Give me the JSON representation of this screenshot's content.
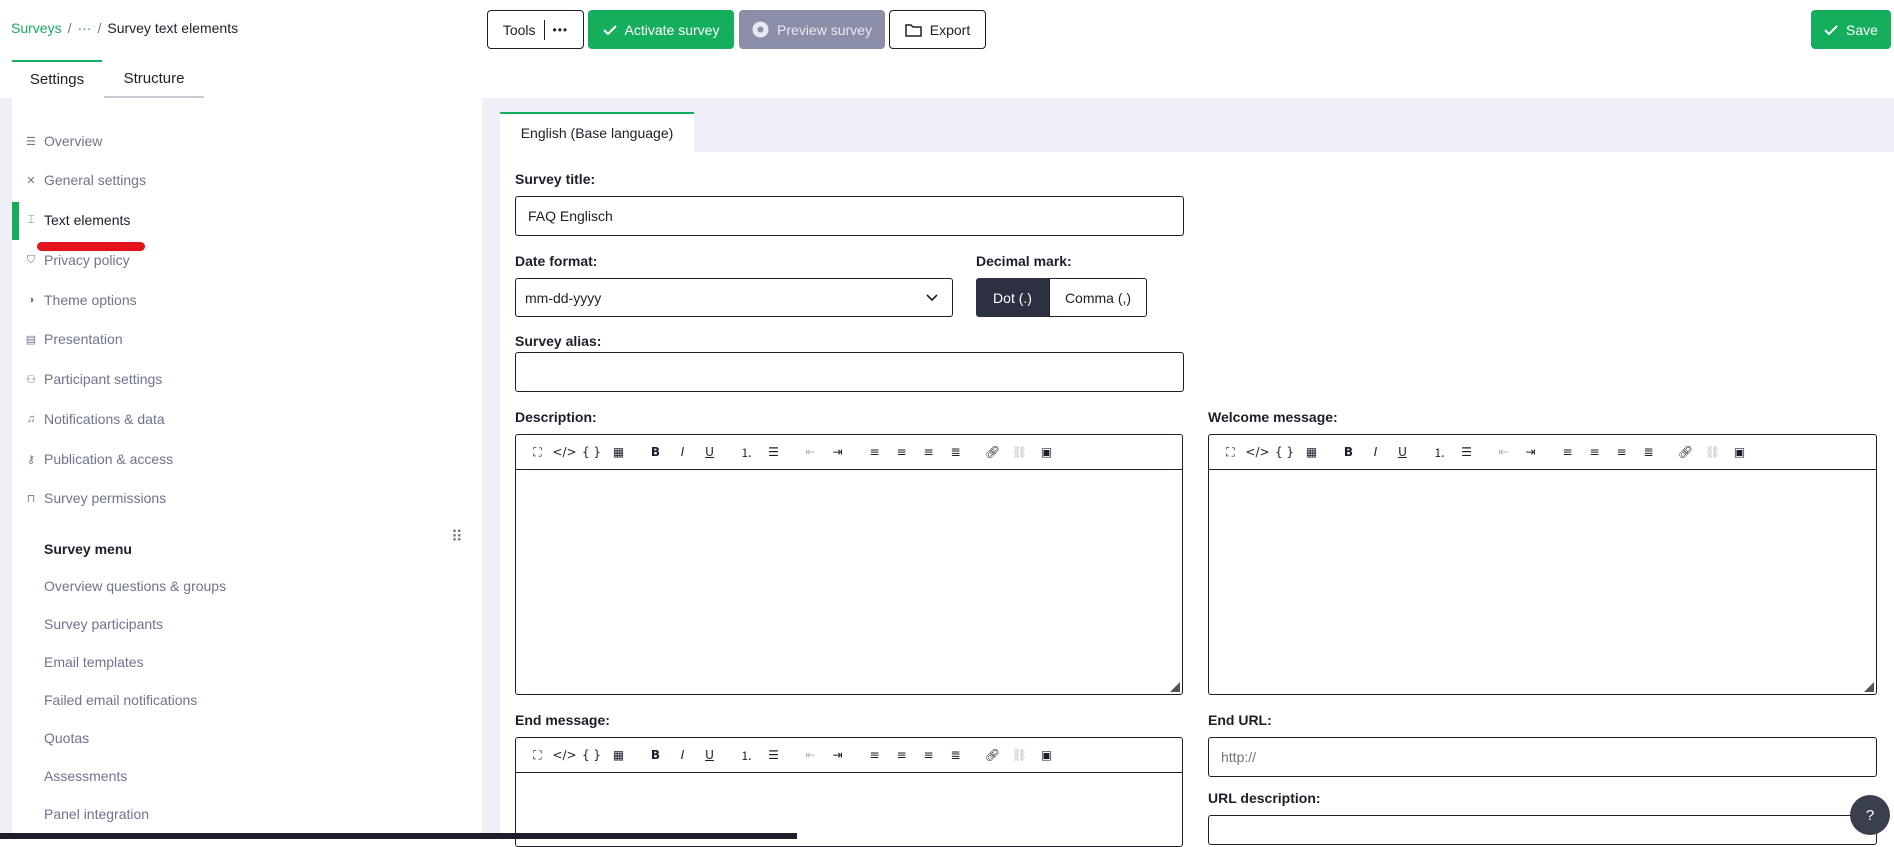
{
  "breadcrumb": {
    "root": "Surveys",
    "ellipsis": "···",
    "current": "Survey text elements"
  },
  "toolbar": {
    "tools_label": "Tools",
    "tools_more": "•••",
    "activate_label": "Activate survey",
    "preview_label": "Preview survey",
    "export_label": "Export",
    "save_label": "Save"
  },
  "main_tabs": [
    {
      "label": "Settings"
    },
    {
      "label": "Structure"
    }
  ],
  "settings_nav": [
    {
      "label": "Overview",
      "icon": "list-icon"
    },
    {
      "label": "General settings",
      "icon": "tools-icon"
    },
    {
      "label": "Text elements",
      "icon": "text-icon"
    },
    {
      "label": "Privacy policy",
      "icon": "shield-icon"
    },
    {
      "label": "Theme options",
      "icon": "contrast-icon"
    },
    {
      "label": "Presentation",
      "icon": "presentation-icon"
    },
    {
      "label": "Participant settings",
      "icon": "participants-icon"
    },
    {
      "label": "Notifications & data",
      "icon": "bell-icon"
    },
    {
      "label": "Publication & access",
      "icon": "key-icon"
    },
    {
      "label": "Survey permissions",
      "icon": "lock-icon"
    }
  ],
  "survey_menu": {
    "title": "Survey menu",
    "items": [
      {
        "label": "Overview questions & groups"
      },
      {
        "label": "Survey participants"
      },
      {
        "label": "Email templates"
      },
      {
        "label": "Failed email notifications"
      },
      {
        "label": "Quotas"
      },
      {
        "label": "Assessments"
      },
      {
        "label": "Panel integration"
      }
    ]
  },
  "language_tab": "English (Base language)",
  "form": {
    "survey_title_label": "Survey title:",
    "survey_title_value": "FAQ Englisch",
    "date_format_label": "Date format:",
    "date_format_value": "mm-dd-yyyy",
    "decimal_mark_label": "Decimal mark:",
    "decimal_dot": "Dot (.)",
    "decimal_comma": "Comma (,)",
    "survey_alias_label": "Survey alias:",
    "survey_alias_value": "",
    "description_label": "Description:",
    "welcome_label": "Welcome message:",
    "end_message_label": "End message:",
    "end_url_label": "End URL:",
    "end_url_placeholder": "http://",
    "url_description_label": "URL description:"
  },
  "colors": {
    "accent": "#14ae5c",
    "dark": "#1e1e2b",
    "muted": "#6e748c",
    "highlight": "#e3121c"
  }
}
